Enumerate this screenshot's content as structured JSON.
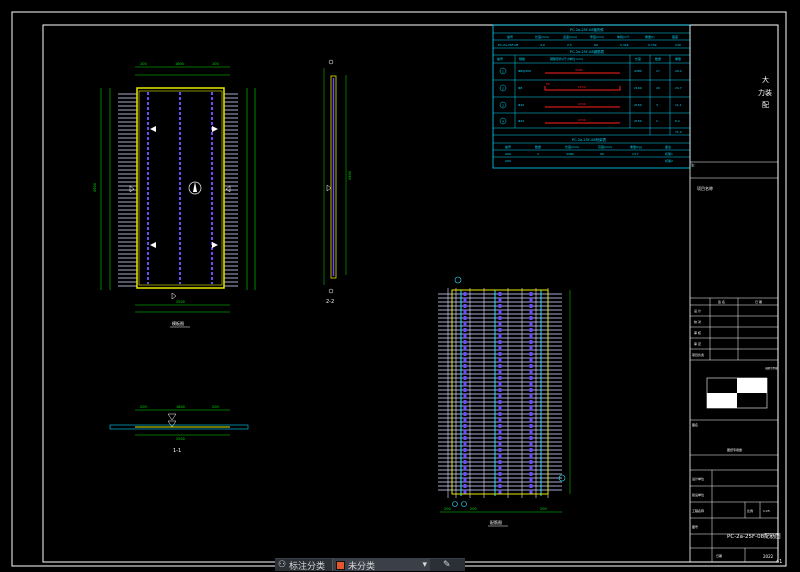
{
  "page_number": "41",
  "company": {
    "line1": "大",
    "line2": "力装",
    "line3": "配"
  },
  "weight_table": {
    "title": "PC-2a-25F-08板构件",
    "headers": [
      "编号",
      "长度(mm)",
      "宽度(mm)",
      "厚度(mm)",
      "体积(m³)",
      "重量(t)",
      "强度"
    ],
    "row": [
      "PC-2a-25F-08",
      "4.9",
      "2.5",
      "60",
      "0.326",
      "0.739",
      "C30"
    ]
  },
  "rebar_table": {
    "title": "PC-2a-25F-08钢筋表",
    "headers": [
      "编号",
      "规格",
      "钢筋形状(尺寸单位:mm)",
      "长度",
      "数量",
      "重量"
    ],
    "rows": [
      {
        "id": "1",
        "spec": "Φ8@200",
        "dim1": "4380",
        "dim2": "",
        "len": "4380",
        "qty": "17",
        "wt": "29.4"
      },
      {
        "id": "2",
        "spec": "Φ8",
        "dim1": "2150",
        "dim2": "65",
        "len": "2160",
        "qty": "29",
        "wt": "24.7"
      },
      {
        "id": "3",
        "spec": "Φ10",
        "dim1": "2150",
        "dim2": "",
        "len": "2150",
        "qty": "3",
        "wt": "11.1"
      },
      {
        "id": "4",
        "spec": "Φ12",
        "dim1": "2150",
        "dim2": "",
        "len": "2150",
        "qty": "2",
        "wt": "6.2"
      }
    ],
    "total": "71.4"
  },
  "truss_table": {
    "title": "PC-2a-25F-08桁架表",
    "headers": [
      "编号",
      "数量",
      "长度(mm)",
      "高度(mm)",
      "重量(kg)",
      "备注"
    ],
    "rows": [
      [
        "A90",
        "3",
        "4380",
        "90",
        "13.7",
        "桁架1"
      ],
      [
        "A90",
        "",
        "",
        "",
        "",
        "桁架2"
      ]
    ]
  },
  "notes_label": "注：",
  "project_label": "项目名称",
  "views": {
    "plan": "模板图",
    "section_22": "2-2",
    "section_11": "1-1",
    "rebar": "配筋图"
  },
  "title_block": {
    "sign_header_a": "签 名",
    "sign_header_b": "日 期",
    "rows": [
      "设 计",
      "校 对",
      "审 核",
      "审 定",
      "项目负责"
    ],
    "seal_label": "出图专用章",
    "drawing_name_label": "图名",
    "drawing_no_label": "图号",
    "scale_label": "比例",
    "scale_value": "1:25",
    "drawing_code": "PC-2a-25F-08配筋图",
    "date_label": "日期",
    "date_value": "2022",
    "stamp_caption": "图纸专用章"
  },
  "bottombar": {
    "annot_label": "标注分类",
    "layer_name": "未分类"
  },
  "colors": {
    "frame": "#ffffff",
    "dim": "#00e000",
    "rebar": "#ffffff",
    "truss": "#6a4cff",
    "edge": "#e8e800",
    "table": "#00d8ff",
    "red": "#ff2020",
    "cyan": "#29e0ff"
  }
}
